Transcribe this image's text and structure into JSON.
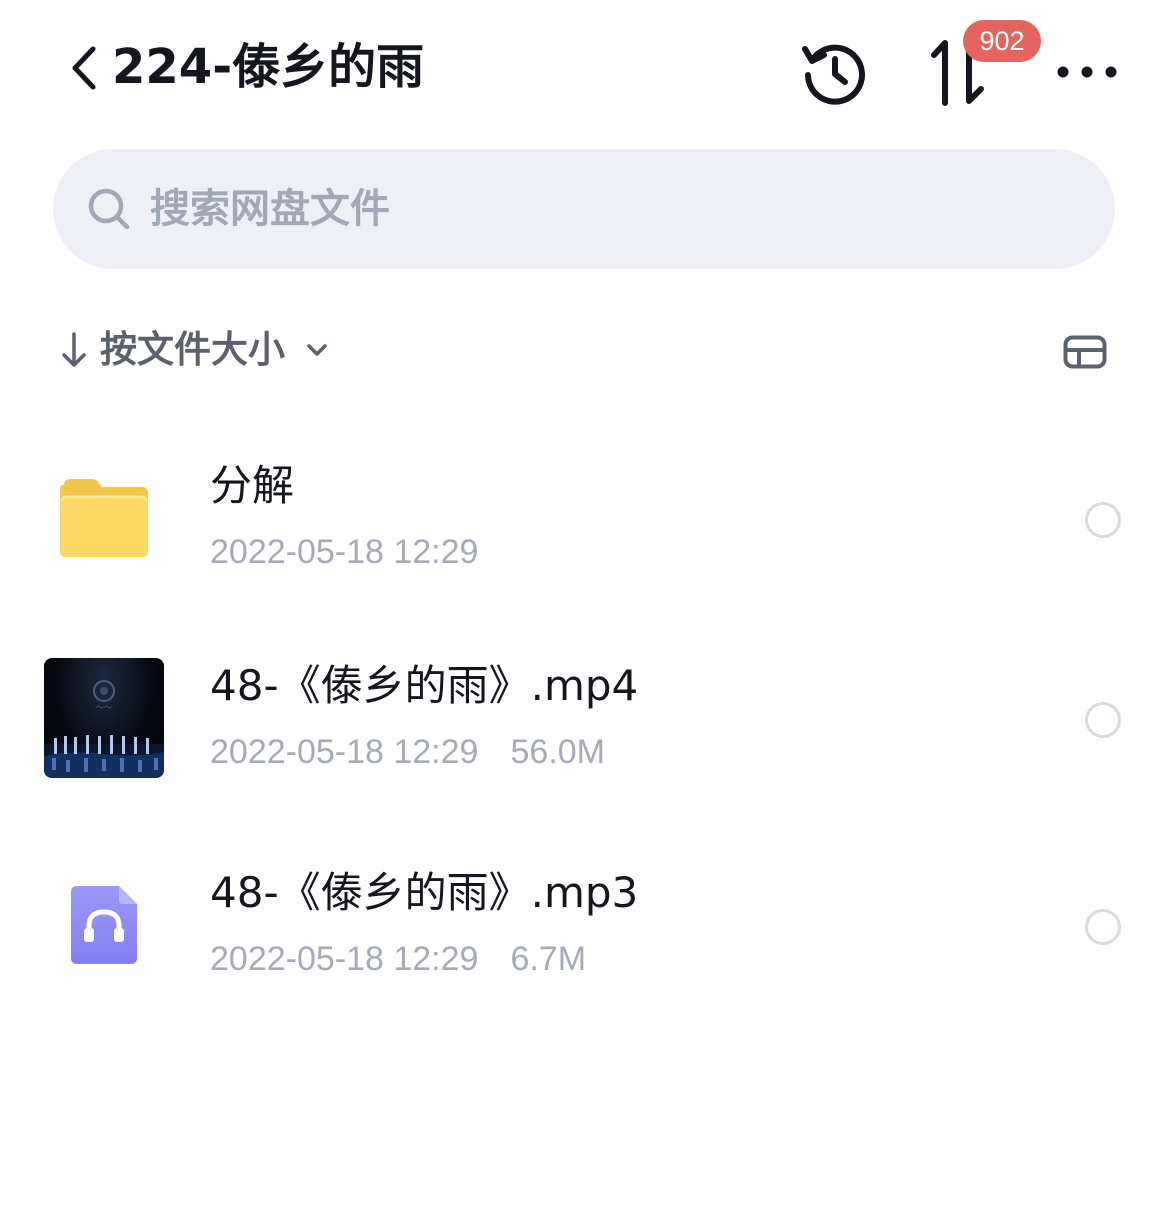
{
  "header": {
    "title": "224-傣乡的雨",
    "badge_count": "902",
    "icons": {
      "back": "chevron-left-icon",
      "history": "history-icon",
      "transfer": "transfer-icon",
      "more": "more-icon"
    }
  },
  "search": {
    "placeholder": "搜索网盘文件",
    "icon": "search-icon"
  },
  "sort": {
    "label": "按文件大小",
    "direction_icon": "arrow-down-icon",
    "dropdown_icon": "chevron-down-icon",
    "view_toggle_icon": "view-toggle-icon"
  },
  "files": [
    {
      "name": "分解",
      "date": "2022-05-18 12:29",
      "size": "",
      "type": "folder",
      "icon": "folder-icon"
    },
    {
      "name": "48-《傣乡的雨》.mp4",
      "date": "2022-05-18 12:29",
      "size": "56.0M",
      "type": "video",
      "icon": "video-thumbnail"
    },
    {
      "name": "48-《傣乡的雨》.mp3",
      "date": "2022-05-18 12:29",
      "size": "6.7M",
      "type": "audio",
      "icon": "audio-file-icon"
    }
  ],
  "colors": {
    "badge": "#e5645e",
    "search_bg": "#eef0f6",
    "meta_text": "#a6abb8",
    "folder": "#f8d25f",
    "audio_icon": "#8f8cf6"
  }
}
